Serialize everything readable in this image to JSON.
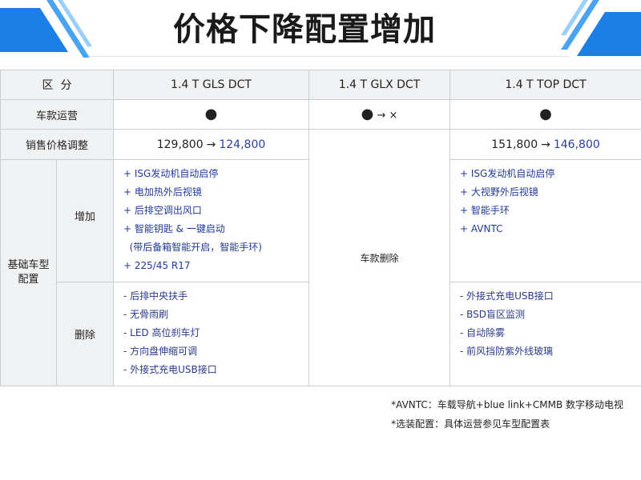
{
  "title": "价格下降配置增加",
  "table": {
    "header": {
      "label": "区  分",
      "models": [
        "1.4 T GLS DCT",
        "1.4 T GLX DCT",
        "1.4 T TOP DCT"
      ]
    },
    "operation_row": {
      "label": "车款运营",
      "gls": "●",
      "glx_dot": "●",
      "glx_arrow": "→",
      "glx_x": "×",
      "top": "●"
    },
    "price_row": {
      "label": "销售价格调整",
      "gls_old": "129,800",
      "gls_arrow": "→",
      "gls_new": "124,800",
      "top_old": "151,800",
      "top_arrow": "→",
      "top_new": "146,800"
    },
    "base_group_label_line1": "基础车型",
    "base_group_label_line2": "配置",
    "add_label": "增加",
    "remove_label": "删除",
    "glx_merged": "车款删除",
    "gls_add": [
      "+ ISG发动机自动启停",
      "+ 电加热外后视镜",
      "+ 后排空调出风口",
      "+ 智能钥匙 & 一键启动",
      "  (带后备箱智能开启，智能手环)",
      "+ 225/45 R17"
    ],
    "top_add": [
      "+ ISG发动机自动启停",
      "+ 大视野外后视镜",
      "+ 智能手环",
      "+ AVNTC"
    ],
    "gls_remove": [
      "- 后排中央扶手",
      "- 无骨雨刷",
      "- LED 高位刹车灯",
      "- 方向盘伸缩可调",
      "- 外接式充电USB接口"
    ],
    "top_remove": [
      "- 外接式充电USB接口",
      "- BSD盲区监测",
      "- 自动除雾",
      "- 前风挡防紫外线玻璃"
    ]
  },
  "notes": [
    "*AVNTC：车载导航+blue link+CMMB 数字移动电视",
    "*选装配置：具体运营参见车型配置表"
  ],
  "colors": {
    "accent_blue": "#1c7fe6",
    "highlight_text": "#2a3fa0"
  }
}
